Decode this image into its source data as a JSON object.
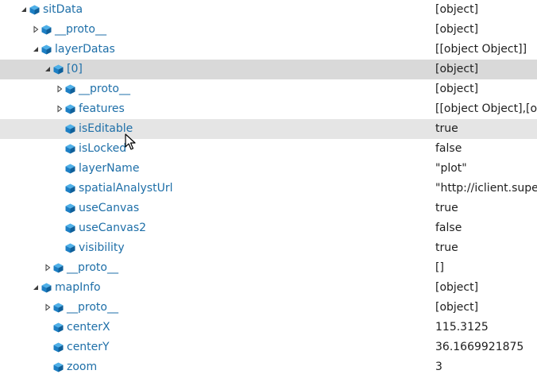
{
  "rows": [
    {
      "name": "sitData",
      "value": "[object]",
      "indent": 0,
      "toggle": "expanded"
    },
    {
      "name": "__proto__",
      "value": "[object]",
      "indent": 1,
      "toggle": "collapsed"
    },
    {
      "name": "layerDatas",
      "value": "[[object Object]]",
      "indent": 1,
      "toggle": "expanded"
    },
    {
      "name": "[0]",
      "value": "[object]",
      "indent": 2,
      "toggle": "expanded",
      "state": "selected"
    },
    {
      "name": "__proto__",
      "value": "[object]",
      "indent": 3,
      "toggle": "collapsed"
    },
    {
      "name": "features",
      "value": "[[object Object],[obj",
      "indent": 3,
      "toggle": "collapsed"
    },
    {
      "name": "isEditable",
      "value": "true",
      "indent": 3,
      "toggle": "none",
      "state": "hover"
    },
    {
      "name": "isLocked",
      "value": "false",
      "indent": 3,
      "toggle": "none"
    },
    {
      "name": "layerName",
      "value": "\"plot\"",
      "indent": 3,
      "toggle": "none"
    },
    {
      "name": "spatialAnalystUrl",
      "value": "\"http://iclient.super",
      "indent": 3,
      "toggle": "none"
    },
    {
      "name": "useCanvas",
      "value": "true",
      "indent": 3,
      "toggle": "none"
    },
    {
      "name": "useCanvas2",
      "value": "false",
      "indent": 3,
      "toggle": "none"
    },
    {
      "name": "visibility",
      "value": "true",
      "indent": 3,
      "toggle": "none"
    },
    {
      "name": "__proto__",
      "value": "[]",
      "indent": 2,
      "toggle": "collapsed"
    },
    {
      "name": "mapInfo",
      "value": "[object]",
      "indent": 1,
      "toggle": "expanded"
    },
    {
      "name": "__proto__",
      "value": "[object]",
      "indent": 2,
      "toggle": "collapsed"
    },
    {
      "name": "centerX",
      "value": "115.3125",
      "indent": 2,
      "toggle": "none"
    },
    {
      "name": "centerY",
      "value": "36.1669921875",
      "indent": 2,
      "toggle": "none"
    },
    {
      "name": "zoom",
      "value": "3",
      "indent": 2,
      "toggle": "none"
    }
  ],
  "colors": {
    "name_text": "#1e6fa8",
    "value_text": "#1e1e1e",
    "selected_row": "#d9d9d9",
    "hover_row": "#e5e5e5",
    "cube_top": "#4fb0e8",
    "cube_left": "#1d7fc4",
    "cube_right": "#10609a"
  },
  "icons": {
    "expanded": "triangle-expanded-icon",
    "collapsed": "triangle-collapsed-icon",
    "property": "property-cube-icon",
    "pointer": "mouse-pointer-icon"
  }
}
